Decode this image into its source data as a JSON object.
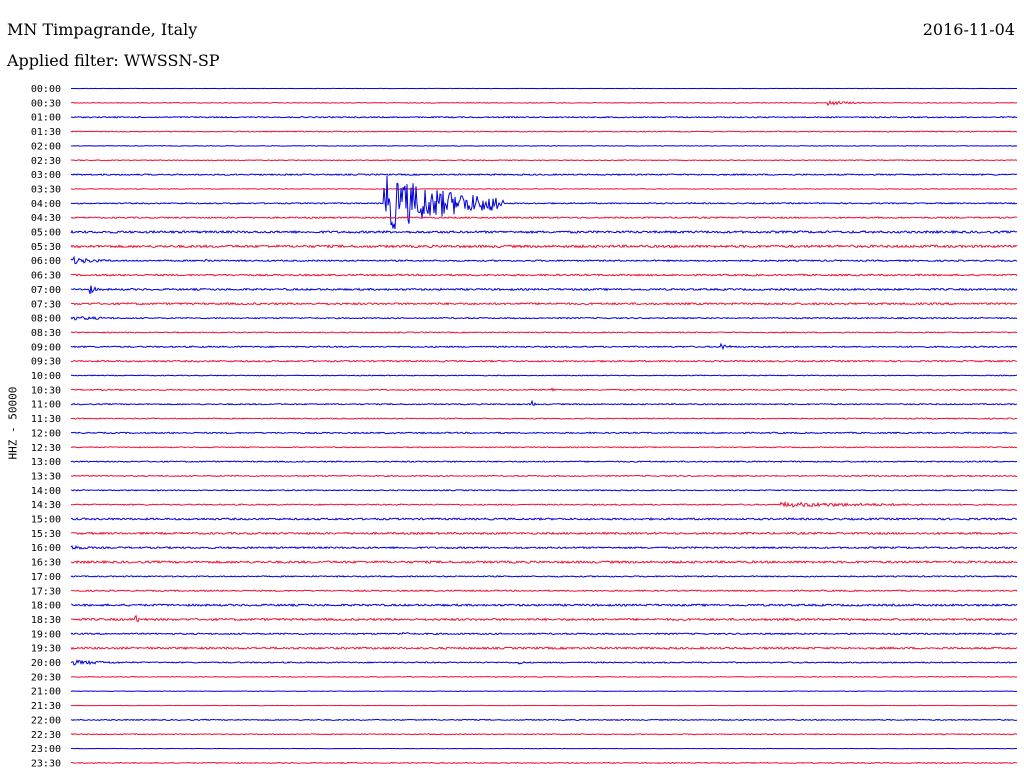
{
  "header": {
    "station": "MN Timpagrande, Italy",
    "filter": "Applied filter: WWSSN-SP",
    "date": "2016-11-04"
  },
  "colors": {
    "even_trace": "#0000dd",
    "odd_trace": "#ee1133"
  },
  "chart_data": {
    "type": "line",
    "title": "MN Timpagrande, Italy",
    "subtitle": "Applied filter: WWSSN-SP",
    "date": "2016-11-04",
    "ylabel": "HHZ - 50000",
    "row_labels": [
      "00:00",
      "00:30",
      "01:00",
      "01:30",
      "02:00",
      "02:30",
      "03:00",
      "03:30",
      "04:00",
      "04:30",
      "05:00",
      "05:30",
      "06:00",
      "06:30",
      "07:00",
      "07:30",
      "08:00",
      "08:30",
      "09:00",
      "09:30",
      "10:00",
      "10:30",
      "11:00",
      "11:30",
      "12:00",
      "12:30",
      "13:00",
      "13:30",
      "14:00",
      "14:30",
      "15:00",
      "15:30",
      "16:00",
      "16:30",
      "17:00",
      "17:30",
      "18:00",
      "18:30",
      "19:00",
      "19:30",
      "20:00",
      "20:30",
      "21:00",
      "21:30",
      "22:00",
      "22:30",
      "23:00",
      "23:30"
    ],
    "x_unit": "minutes within 30-minute trace",
    "xlim": [
      0,
      30
    ],
    "noise_level": [
      0.3,
      0.6,
      1.0,
      0.8,
      0.5,
      0.7,
      1.1,
      0.6,
      1.0,
      1.2,
      1.8,
      2.0,
      1.2,
      1.4,
      1.5,
      1.6,
      1.0,
      0.9,
      1.1,
      1.3,
      0.7,
      1.0,
      1.0,
      0.9,
      1.1,
      0.8,
      1.0,
      1.0,
      0.9,
      1.0,
      1.5,
      1.6,
      1.4,
      1.8,
      1.0,
      1.1,
      1.6,
      1.7,
      1.2,
      1.6,
      1.0,
      0.6,
      0.4,
      0.4,
      0.9,
      0.8,
      0.3,
      0.8
    ],
    "events": [
      {
        "row": 1,
        "minute": 24.0,
        "amplitude": 2.5,
        "duration": 1.2
      },
      {
        "row": 8,
        "minute": 9.9,
        "amplitude": 30,
        "duration": 3.8,
        "note": "earthquake"
      },
      {
        "row": 12,
        "minute": 0.0,
        "amplitude": 4,
        "duration": 1.3
      },
      {
        "row": 12,
        "minute": 4.2,
        "amplitude": 3,
        "duration": 0.4
      },
      {
        "row": 14,
        "minute": 0.6,
        "amplitude": 5,
        "duration": 0.3
      },
      {
        "row": 16,
        "minute": 0.0,
        "amplitude": 2,
        "duration": 2.5
      },
      {
        "row": 18,
        "minute": 20.6,
        "amplitude": 5,
        "duration": 0.3
      },
      {
        "row": 21,
        "minute": 15.2,
        "amplitude": 3,
        "duration": 0.3
      },
      {
        "row": 22,
        "minute": 14.6,
        "amplitude": 3.5,
        "duration": 0.2
      },
      {
        "row": 29,
        "minute": 22.5,
        "amplitude": 2.5,
        "duration": 7.0
      },
      {
        "row": 32,
        "minute": 0.0,
        "amplitude": 2,
        "duration": 1.5
      },
      {
        "row": 37,
        "minute": 2.0,
        "amplitude": 5,
        "duration": 0.4
      },
      {
        "row": 38,
        "minute": 10.5,
        "amplitude": 3,
        "duration": 0.3
      },
      {
        "row": 40,
        "minute": 0.0,
        "amplitude": 2.5,
        "duration": 2.3
      },
      {
        "row": 40,
        "minute": 14.2,
        "amplitude": 3,
        "duration": 0.2
      },
      {
        "row": 45,
        "minute": 9.9,
        "amplitude": 2,
        "duration": 0.1
      },
      {
        "row": 45,
        "minute": 22.3,
        "amplitude": 2,
        "duration": 0.1
      }
    ],
    "grid": false
  }
}
